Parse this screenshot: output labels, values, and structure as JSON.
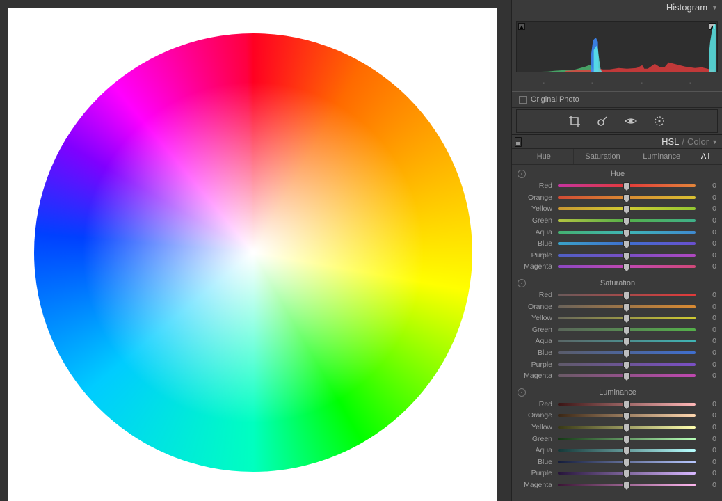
{
  "panels": {
    "histogram": {
      "title": "Histogram"
    },
    "hsl": {
      "title_strong": "HSL",
      "title_sep": " / ",
      "title_dim": "Color"
    }
  },
  "histogram_readout": {
    "v1": "-",
    "v2": "-",
    "v3": "-",
    "v4": "-"
  },
  "original_photo": {
    "label": "Original Photo",
    "checked": false
  },
  "subtabs": {
    "hue": "Hue",
    "saturation": "Saturation",
    "luminance": "Luminance",
    "all": "All",
    "active": "All"
  },
  "sections": {
    "hue": {
      "title": "Hue"
    },
    "saturation": {
      "title": "Saturation"
    },
    "luminance": {
      "title": "Luminance"
    }
  },
  "colors": {
    "red": "Red",
    "orange": "Orange",
    "yellow": "Yellow",
    "green": "Green",
    "aqua": "Aqua",
    "blue": "Blue",
    "purple": "Purple",
    "magenta": "Magenta"
  },
  "values": {
    "hue": {
      "red": 0,
      "orange": 0,
      "yellow": 0,
      "green": 0,
      "aqua": 0,
      "blue": 0,
      "purple": 0,
      "magenta": 0
    },
    "saturation": {
      "red": 0,
      "orange": 0,
      "yellow": 0,
      "green": 0,
      "aqua": 0,
      "blue": 0,
      "purple": 0,
      "magenta": 0
    },
    "luminance": {
      "red": 0,
      "orange": 0,
      "yellow": 0,
      "green": 0,
      "aqua": 0,
      "blue": 0,
      "purple": 0,
      "magenta": 0
    }
  }
}
